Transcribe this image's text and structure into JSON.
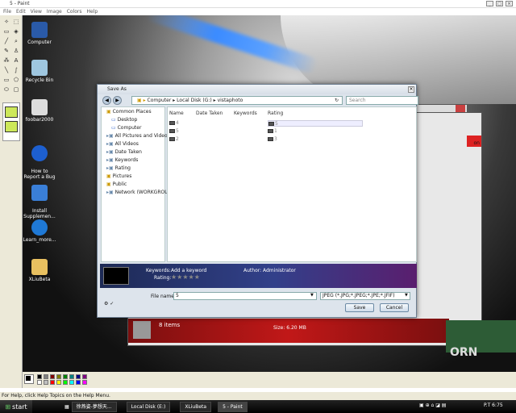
{
  "window": {
    "title": "5 - Paint"
  },
  "menu": [
    "File",
    "Edit",
    "View",
    "Image",
    "Colors",
    "Help"
  ],
  "desktop_icons": [
    {
      "label": "Computer",
      "color": "#2a5aa8"
    },
    {
      "label": "Recycle Bin",
      "color": "#9fc7e0"
    },
    {
      "label": "foobar2000",
      "color": "#ddd"
    },
    {
      "label": "How to\nReport a Bug",
      "color": "#1d5fcf"
    },
    {
      "label": "Install\nSupplemen...",
      "color": "#3a7fd8"
    },
    {
      "label": "Learn_more...",
      "color": "#1f79d6"
    },
    {
      "label": "XLiuBeta",
      "color": "#e8c060"
    }
  ],
  "dialog": {
    "title": "Save As",
    "path": [
      "Computer",
      "Local Disk (G:)",
      "vistaphoto"
    ],
    "search_placeholder": "Search",
    "nav": [
      {
        "label": "Common Places",
        "level": 0
      },
      {
        "label": "Desktop",
        "level": 1
      },
      {
        "label": "Computer",
        "level": 1
      },
      {
        "label": "All Pictures and Videos",
        "level": 0
      },
      {
        "label": "All Videos",
        "level": 0
      },
      {
        "label": "Date Taken",
        "level": 0
      },
      {
        "label": "Keywords",
        "level": 0
      },
      {
        "label": "Rating",
        "level": 0
      },
      {
        "label": "Pictures",
        "level": 0
      },
      {
        "label": "Public",
        "level": 0
      },
      {
        "label": "Network (WORKGROUP",
        "level": 0
      }
    ],
    "columns": [
      "Name",
      "Date Taken",
      "Keywords",
      "Rating"
    ],
    "files_name": [
      "4",
      "5",
      "2"
    ],
    "files_rating": [
      "5",
      "1",
      "3"
    ],
    "metadata": {
      "keywords_label": "Keywords:",
      "keywords_value": "Add a keyword",
      "author_label": "Author:",
      "author_value": "Administrator",
      "rating_label": "Rating:",
      "rating_stars": "★★★★★"
    },
    "filename_label": "File name:",
    "filename_value": "5",
    "filetype_value": "JPEG (*.JPG;*.JPEG;*.JPE;*.JFIF)",
    "save_label": "Save",
    "cancel_label": "Cancel"
  },
  "bg_window": {
    "items": "8 items",
    "size": "Size: 6.20 MB",
    "partial_text": "on",
    "brand": "ORN"
  },
  "status_text": "For Help, click Help Topics on the Help Menu.",
  "taskbar": {
    "start": "start",
    "tasks": [
      "徐燕姿-夢想天...",
      "Local Disk (E:)",
      "XLiuBeta",
      "5 - Paint"
    ],
    "clock": "P.T 6:75"
  },
  "palette_colors": [
    "#000000",
    "#808080",
    "#800000",
    "#808000",
    "#008000",
    "#008080",
    "#000080",
    "#800080",
    "#ffffff",
    "#c0c0c0",
    "#ff0000",
    "#ffff00",
    "#00ff00",
    "#00ffff",
    "#0000ff",
    "#ff00ff"
  ]
}
